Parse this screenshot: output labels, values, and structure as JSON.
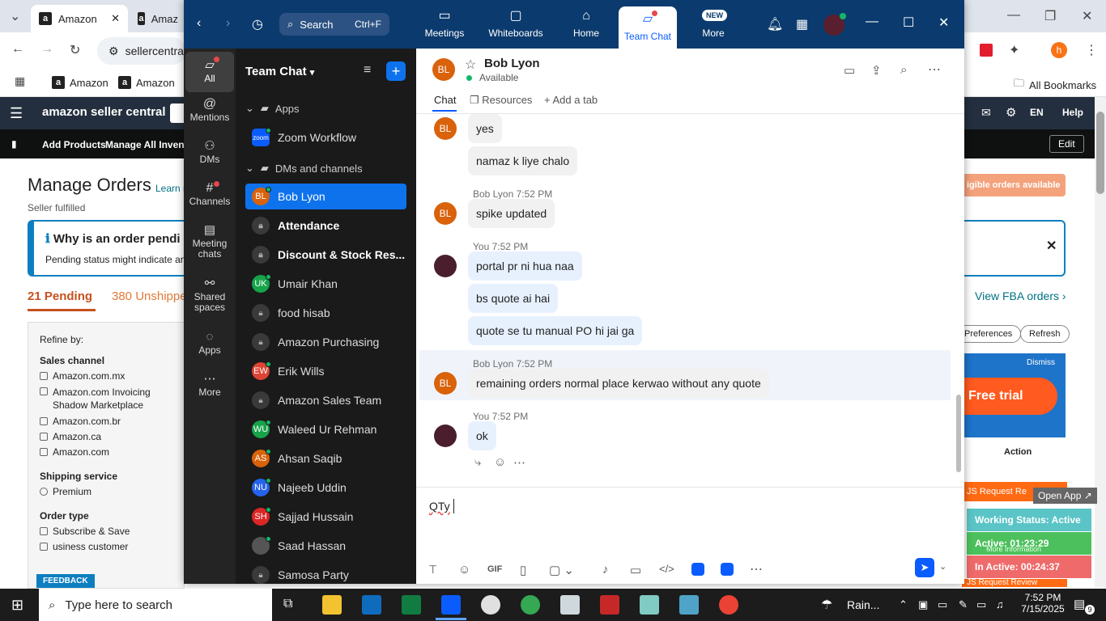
{
  "chrome": {
    "tabs": [
      {
        "title": "Amazon"
      },
      {
        "title": "Amaz"
      }
    ],
    "address": "sellercentra",
    "bookmarks": [
      "Amazon",
      "Amazon"
    ],
    "all_bookmarks": "All Bookmarks",
    "profile_initial": "h"
  },
  "amazon": {
    "logo": "amazon seller central",
    "nav_right": {
      "lang": "EN",
      "help": "Help"
    },
    "subnav": [
      "Add Products",
      "Manage All Inventor"
    ],
    "edit": "Edit",
    "page_title": "Manage Orders",
    "learn": "Learn n",
    "fulfilled": "Seller fulfilled",
    "banner_title": "Why is an order pendi",
    "banner_text": "Pending status might indicate an",
    "eligible": "igible orders available",
    "tabs": {
      "pending": "21 Pending",
      "unshipped": "380 Unshippe"
    },
    "view_fba": "View FBA orders",
    "preferences": "Preferences",
    "refresh": "Refresh",
    "dismiss": "Dismiss",
    "free_trial": "Free trial",
    "action": "Action",
    "refine": "Refine by:",
    "sales_channel": "Sales channel",
    "channels": [
      "Amazon.com.mx",
      "Amazon.com Invoicing Shadow Marketplace",
      "Amazon.com.br",
      "Amazon.ca",
      "Amazon.com"
    ],
    "shipping_service": "Shipping service",
    "shipping_options": [
      "Premium"
    ],
    "order_type": "Order type",
    "order_types": [
      "Subscribe & Save",
      "usiness customer"
    ],
    "feedback": "FEEDBACK",
    "request_review_1": "JS  Request Re",
    "request_review_2": "JS  Request Review"
  },
  "extension": {
    "open_app": "Open App ↗",
    "working_status": "Working Status: Active",
    "active": "Active: 01:23:29",
    "more_info": "More Information",
    "inactive": "In Active: 00:24:37"
  },
  "zoom": {
    "search_label": "Search",
    "search_shortcut": "Ctrl+F",
    "top_tabs": [
      {
        "label": "Meetings"
      },
      {
        "label": "Whiteboards"
      },
      {
        "label": "Home"
      },
      {
        "label": "Team Chat"
      },
      {
        "label": "More",
        "badge": "NEW"
      }
    ],
    "rail": [
      "All",
      "Mentions",
      "DMs",
      "Channels",
      "Meeting chats",
      "Shared spaces",
      "Apps",
      "More"
    ],
    "sidebar_title": "Team Chat",
    "section_apps": "Apps",
    "app_item": "Zoom Workflow",
    "app_item_logo": "zoom",
    "section_dms": "DMs and channels",
    "dms": [
      {
        "name": "Bob Lyon",
        "initials": "BL",
        "color": "#d9620b",
        "type": "dm",
        "active": true
      },
      {
        "name": "Attendance",
        "type": "channel",
        "bold": true
      },
      {
        "name": "Discount & Stock Res...",
        "type": "channel",
        "bold": true
      },
      {
        "name": "Umair Khan",
        "initials": "UK",
        "color": "#16a34a",
        "type": "dm"
      },
      {
        "name": "food hisab",
        "type": "channel"
      },
      {
        "name": "Amazon Purchasing",
        "type": "channel"
      },
      {
        "name": "Erik Wills",
        "initials": "EW",
        "color": "#dc4433",
        "type": "dm"
      },
      {
        "name": "Amazon Sales Team",
        "type": "channel"
      },
      {
        "name": "Waleed Ur Rehman",
        "initials": "WU",
        "color": "#16a34a",
        "type": "dm"
      },
      {
        "name": "Ahsan Saqib",
        "initials": "AS",
        "color": "#d9620b",
        "type": "dm"
      },
      {
        "name": "Najeeb Uddin",
        "initials": "NU",
        "color": "#2563eb",
        "type": "dm"
      },
      {
        "name": "Sajjad Hussain",
        "initials": "SH",
        "color": "#dc2626",
        "type": "dm"
      },
      {
        "name": "Saad Hassan",
        "initials": "",
        "color": "#555555",
        "type": "dm"
      },
      {
        "name": "Samosa Party",
        "type": "channel"
      }
    ],
    "contact": {
      "name": "Bob Lyon",
      "initials": "BL",
      "status": "Available"
    },
    "chat_tabs": [
      "Chat",
      "Resources",
      "Add a tab"
    ],
    "messages": [
      {
        "kind": "bubble",
        "text": "yes",
        "side": "in",
        "avatar": "BL"
      },
      {
        "kind": "bubble",
        "text": "namaz k liye chalo",
        "side": "in"
      },
      {
        "kind": "meta",
        "text": "Bob Lyon 7:52 PM"
      },
      {
        "kind": "bubble",
        "text": "spike updated",
        "side": "in",
        "avatar": "BL"
      },
      {
        "kind": "meta",
        "text": "You 7:52 PM"
      },
      {
        "kind": "bubble",
        "text": "portal pr ni hua naa",
        "side": "out",
        "avatar": "you"
      },
      {
        "kind": "bubble",
        "text": "bs quote ai hai",
        "side": "out"
      },
      {
        "kind": "bubble",
        "text": "quote se tu manual PO hi jai ga",
        "side": "out"
      },
      {
        "kind": "meta",
        "text": "Bob Lyon 7:52 PM"
      },
      {
        "kind": "bubble",
        "text": "remaining orders normal place kerwao without any quote",
        "side": "in",
        "avatar": "BL"
      },
      {
        "kind": "meta",
        "text": "You 7:52 PM"
      },
      {
        "kind": "bubble",
        "text": "ok",
        "side": "out",
        "avatar": "you"
      }
    ],
    "compose_text": "QTy"
  },
  "taskbar": {
    "search_placeholder": "Type here to search",
    "weather": "Rain...",
    "time": "7:52 PM",
    "date": "7/15/2025",
    "notif_count": "9"
  },
  "colors": {
    "zoom_blue": "#0b5cff",
    "zoom_header": "#0b3b6e",
    "amazon_nav": "#232f3e",
    "orange": "#f97316"
  }
}
